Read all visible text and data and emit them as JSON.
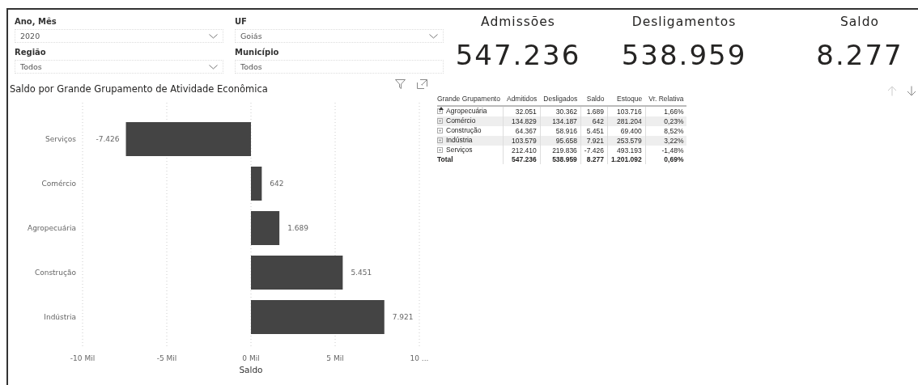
{
  "slicers": [
    {
      "label": "Ano, Mês",
      "value": "2020",
      "dropdown_arrow": true
    },
    {
      "label": "UF",
      "value": "Goiás",
      "dropdown_arrow": true
    },
    {
      "label": "Região",
      "value": "Todos",
      "dropdown_arrow": true
    },
    {
      "label": "Município",
      "value": "Todos",
      "dropdown_arrow": false
    }
  ],
  "chart": {
    "title": "Saldo por Grande Grupamento de Atividade Econômica",
    "bar_labels": [
      "-7.426",
      "642",
      "1.689",
      "5.451",
      "7.921"
    ],
    "chart_data": {
      "type": "bar",
      "orientation": "horizontal",
      "xlabel": "Saldo",
      "categories": [
        "Serviços",
        "Comércio",
        "Agropecuária",
        "Construção",
        "Indústria"
      ],
      "values": [
        -7.426,
        0.642,
        1.689,
        5.451,
        7.921
      ],
      "grid": true,
      "xlim": [
        -10,
        10
      ],
      "xticks": [
        {
          "value": -10,
          "label": "-10 Mil"
        },
        {
          "value": -5,
          "label": "-5 Mil"
        },
        {
          "value": 0,
          "label": "0 Mil"
        },
        {
          "value": 5,
          "label": "5 Mil"
        },
        {
          "value": 10,
          "label": "10 ..."
        }
      ]
    }
  },
  "kpis": [
    {
      "title": "Admissões",
      "value": "547.236"
    },
    {
      "title": "Desligamentos",
      "value": "538.959"
    },
    {
      "title": "Saldo",
      "value": "8.277"
    }
  ],
  "table": {
    "columns": [
      "Grande Grupamento",
      "Admitidos",
      "Desligados",
      "Saldo",
      "Estoque",
      "Vr. Relativa"
    ],
    "rows": [
      [
        "Agropecuária",
        "32.051",
        "30.362",
        "1.689",
        "103.716",
        "1,66%"
      ],
      [
        "Comércio",
        "134.829",
        "134.187",
        "642",
        "281.204",
        "0,23%"
      ],
      [
        "Construção",
        "64.367",
        "58.916",
        "5.451",
        "69.400",
        "8,52%"
      ],
      [
        "Indústria",
        "103.579",
        "95.658",
        "7.921",
        "253.579",
        "3,22%"
      ],
      [
        "Serviços",
        "212.410",
        "219.836",
        "-7.426",
        "493.193",
        "-1,48%"
      ]
    ],
    "total": [
      "Total",
      "547.236",
      "538.959",
      "8.277",
      "1.201.092",
      "0,69%"
    ]
  }
}
